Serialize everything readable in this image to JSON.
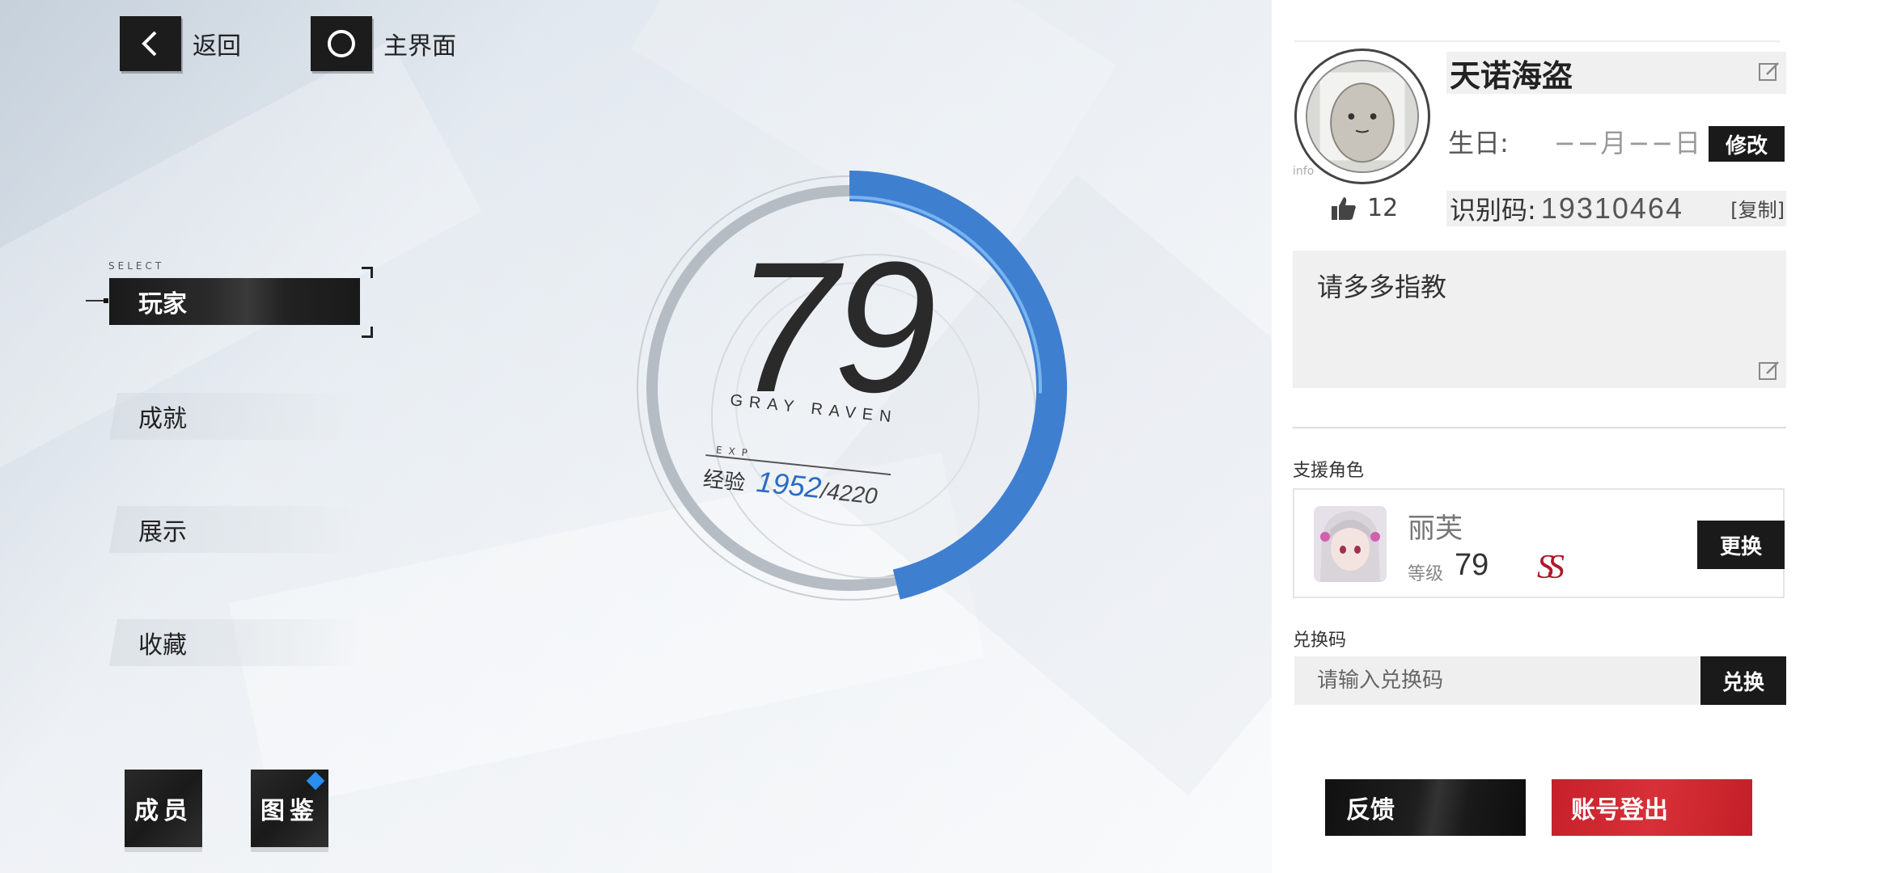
{
  "nav": {
    "back_label": "返回",
    "home_label": "主界面"
  },
  "menu": {
    "select_tag": "SELECT",
    "items": [
      {
        "label": "玩家",
        "active": true
      },
      {
        "label": "成就",
        "active": false
      },
      {
        "label": "展示",
        "active": false
      },
      {
        "label": "收藏",
        "active": false
      }
    ]
  },
  "bottom_buttons": {
    "members_label": "成员",
    "gallery_label": "图鉴"
  },
  "level": {
    "value": "79",
    "subtitle": "GRAY RAVEN",
    "exp_tag": "EXP",
    "exp_label": "经验",
    "exp_current": "1952",
    "exp_max": "/4220",
    "exp_progress": 0.4626
  },
  "profile": {
    "avatar_tag": "info",
    "name": "天诺海盗",
    "birthday_label": "生日:",
    "birthday_value": "−−月−−日",
    "modify_label": "修改",
    "likes": "12",
    "uid_label": "识别码:",
    "uid_value": "19310464",
    "copy_label": "[复制]",
    "signature": "请多多指教"
  },
  "support": {
    "section_label": "支援角色",
    "name": "丽芙",
    "level_label": "等级",
    "level": "79",
    "rank": "SS",
    "change_label": "更换"
  },
  "redeem": {
    "section_label": "兑换码",
    "placeholder": "请输入兑换码",
    "button_label": "兑换"
  },
  "footer": {
    "feedback_label": "反馈",
    "logout_label": "账号登出"
  },
  "colors": {
    "accent_blue": "#3f7fd0",
    "logout_red": "#cc2530",
    "dark": "#1a1a1a"
  },
  "icons": {
    "back": "chevron-left-icon",
    "home": "circle-icon",
    "edit": "edit-icon",
    "like": "thumbs-up-icon",
    "notif": "diamond-badge-icon"
  }
}
